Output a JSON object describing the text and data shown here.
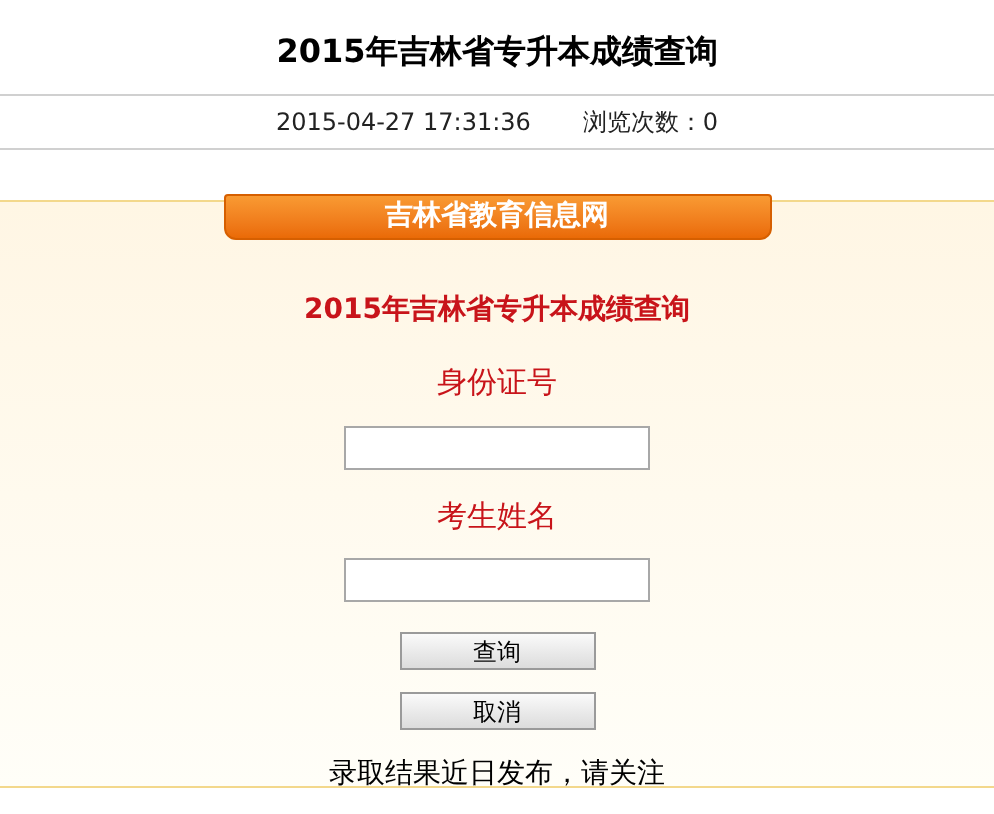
{
  "page_title": "2015年吉林省专升本成绩查询",
  "info_bar": {
    "datetime": "2015-04-27 17:31:36",
    "views_label": "浏览次数：0"
  },
  "panel": {
    "banner": "吉林省教育信息网",
    "form_title": "2015年吉林省专升本成绩查询",
    "fields": [
      {
        "label": "身份证号"
      },
      {
        "label": "考生姓名"
      }
    ],
    "buttons": [
      "查询",
      "取消"
    ],
    "note": "录取结果近日发布，请关注"
  }
}
